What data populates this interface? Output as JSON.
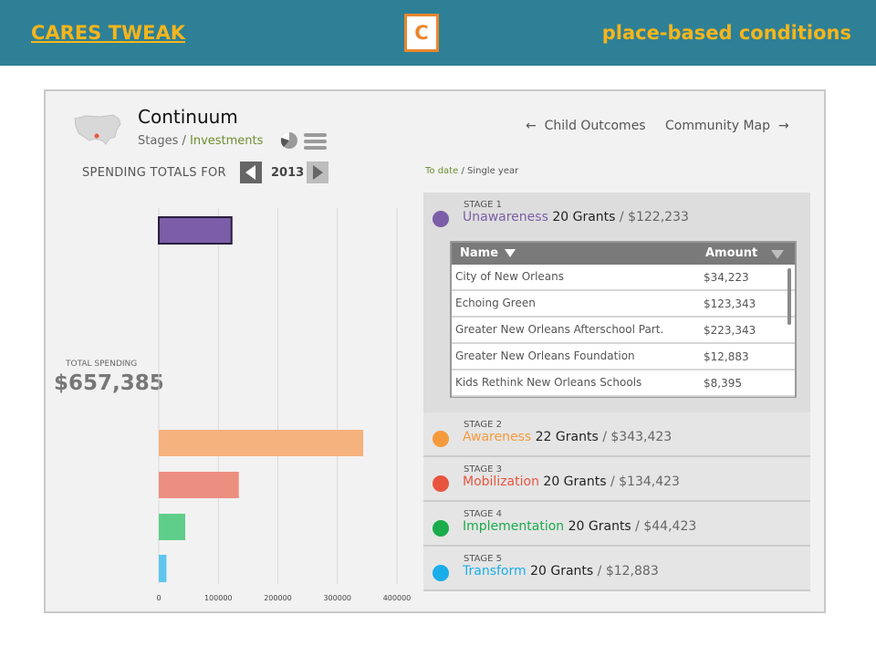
{
  "header": {
    "brand": "CARES TWEAK",
    "logo_letter": "C",
    "tagline": "place-based conditions",
    "colors": {
      "bar": "#2e8096",
      "accent": "#f5b51c",
      "logo": "#e9862e"
    }
  },
  "panel": {
    "title": "Continuum",
    "subtitle_a": "Stages",
    "subtitle_sep": " / ",
    "subtitle_b": "Investments",
    "map_icon": "us-map-icon",
    "nav_child": "Child Outcomes",
    "nav_community": "Community Map",
    "spending_label": "SPENDING TOTALS FOR",
    "year": "2013",
    "toggle_a": "To date",
    "toggle_sep": " / ",
    "toggle_b": "Single year",
    "total_label": "TOTAL SPENDING",
    "total_value": "$657,385"
  },
  "stages": [
    {
      "stage": "STAGE 1",
      "name": "Unawareness",
      "grants": "20 Grants",
      "sep": " / ",
      "amount": "$122,233",
      "color": "#7b5ea7",
      "table": {
        "col_name": "Name",
        "col_amount": "Amount",
        "rows": [
          {
            "name": "City of New Orleans",
            "amount": "$34,223"
          },
          {
            "name": "Echoing Green",
            "amount": "$123,343"
          },
          {
            "name": "Greater New Orleans Afterschool Part.",
            "amount": "$223,343"
          },
          {
            "name": "Greater New Orleans Foundation",
            "amount": "$12,883"
          },
          {
            "name": "Kids Rethink New Orleans Schools",
            "amount": "$8,395"
          }
        ]
      }
    },
    {
      "stage": "STAGE 2",
      "name": "Awareness",
      "grants": "22 Grants",
      "sep": " / ",
      "amount": "$343,423",
      "color": "#f59a3c"
    },
    {
      "stage": "STAGE 3",
      "name": "Mobilization",
      "grants": "20 Grants",
      "sep": " / ",
      "amount": "$134,423",
      "color": "#e8553f"
    },
    {
      "stage": "STAGE 4",
      "name": "Implementation",
      "grants": "20 Grants",
      "sep": " / ",
      "amount": "$44,423",
      "color": "#1aab4c"
    },
    {
      "stage": "STAGE 5",
      "name": "Transform",
      "grants": "20 Grants",
      "sep": " / ",
      "amount": "$12,883",
      "color": "#1aaee8"
    }
  ],
  "chart_data": {
    "type": "bar",
    "orientation": "horizontal",
    "categories": [
      "Unawareness",
      "Awareness",
      "Mobilization",
      "Implementation",
      "Transform"
    ],
    "values": [
      122233,
      343423,
      134423,
      44423,
      12883
    ],
    "colors": [
      "#7b5ea7",
      "#f5b27f",
      "#ec8f80",
      "#5fce8a",
      "#5fc6ef"
    ],
    "highlight_index": 0,
    "xlim": [
      0,
      400000
    ],
    "xticks": [
      0,
      100000,
      200000,
      300000,
      400000
    ],
    "xtick_labels": [
      "0",
      "100000",
      "200000",
      "300000",
      "400000"
    ],
    "grid": true
  }
}
